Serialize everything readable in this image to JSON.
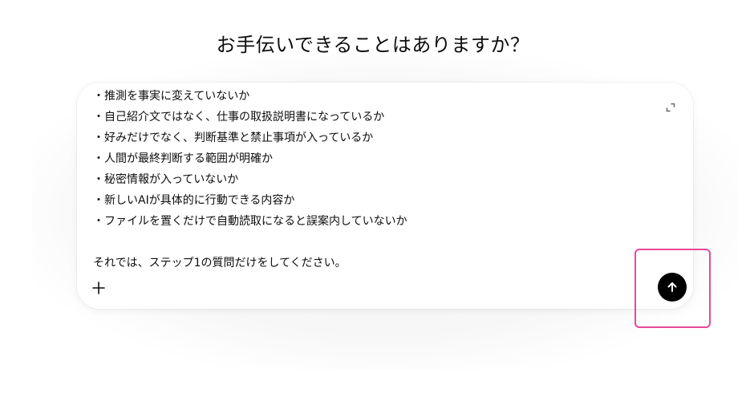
{
  "page": {
    "heading": "お手伝いできることはありますか？"
  },
  "composer": {
    "lines": [
      "・推測を事実に変えていないか",
      "・自己紹介文ではなく、仕事の取扱説明書になっているか",
      "・好みだけでなく、判断基準と禁止事項が入っているか",
      "・人間が最終判断する範囲が明確か",
      "・秘密情報が入っていないか",
      "・新しいAIが具体的に行動できる内容か",
      "・ファイルを置くだけで自動読取になると誤案内していないか",
      "",
      "それでは、ステップ1の質問だけをしてください。"
    ],
    "expand_icon": "expand-icon",
    "plus_icon": "plus-icon",
    "send_icon": "arrow-up-icon"
  },
  "colors": {
    "send_button_bg": "#000000",
    "highlight": "#e8489a",
    "text": "#0d0d0d"
  }
}
